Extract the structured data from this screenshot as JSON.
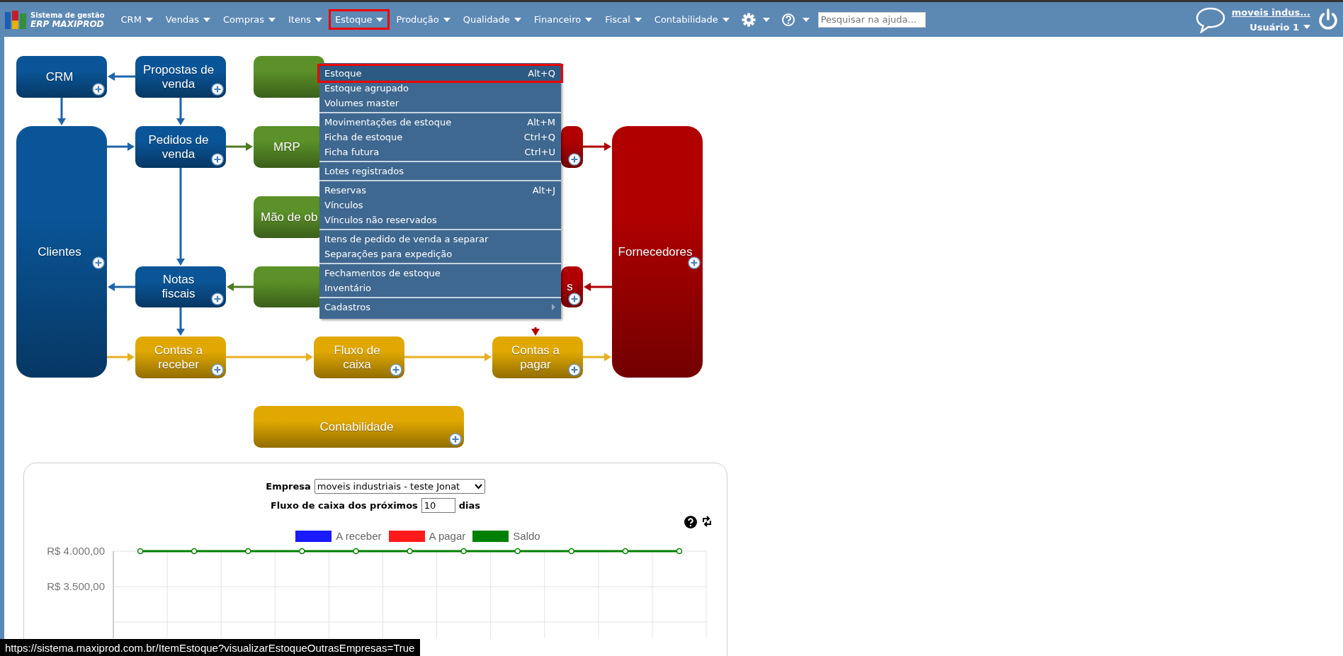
{
  "header": {
    "logo_line1": "Sistema de gestão",
    "logo_line2": "ERP MAXIPROD",
    "nav": [
      {
        "label": "CRM",
        "selected": false
      },
      {
        "label": "Vendas",
        "selected": false
      },
      {
        "label": "Compras",
        "selected": false
      },
      {
        "label": "Itens",
        "selected": false
      },
      {
        "label": "Estoque",
        "selected": true
      },
      {
        "label": "Produção",
        "selected": false
      },
      {
        "label": "Qualidade",
        "selected": false
      },
      {
        "label": "Financeiro",
        "selected": false
      },
      {
        "label": "Fiscal",
        "selected": false
      },
      {
        "label": "Contabilidade",
        "selected": false
      }
    ],
    "tool_menus": [
      {
        "kind": "settings"
      },
      {
        "kind": "help"
      }
    ],
    "search": {
      "placeholder": "Pesquisar na ajuda..."
    },
    "company_link": "moveis indus...",
    "user": "Usuário 1"
  },
  "menu": {
    "groups": [
      {
        "items": [
          {
            "kind": "item",
            "label": "Estoque",
            "shortcut": "Alt+Q",
            "selected": true
          },
          {
            "kind": "item",
            "label": "Estoque agrupado",
            "selected": false
          },
          {
            "kind": "item",
            "label": "Volumes master",
            "selected": false
          }
        ]
      },
      {
        "items": [
          {
            "kind": "item",
            "label": "Movimentações de estoque",
            "shortcut": "Alt+M",
            "selected": false
          },
          {
            "kind": "item",
            "label": "Ficha de estoque",
            "shortcut": "Ctrl+Q",
            "selected": false
          },
          {
            "kind": "item",
            "label": "Ficha futura",
            "shortcut": "Ctrl+U",
            "selected": false
          }
        ]
      },
      {
        "items": [
          {
            "kind": "item",
            "label": "Lotes registrados",
            "selected": false
          }
        ]
      },
      {
        "items": [
          {
            "kind": "item",
            "label": "Reservas",
            "shortcut": "Alt+J",
            "selected": false
          },
          {
            "kind": "item",
            "label": "Vínculos",
            "selected": false
          },
          {
            "kind": "item",
            "label": "Vínculos não reservados",
            "selected": false
          }
        ]
      },
      {
        "items": [
          {
            "kind": "item",
            "label": "Itens de pedido de venda a separar",
            "selected": false
          },
          {
            "kind": "item",
            "label": "Separações para expedição",
            "selected": false
          }
        ]
      },
      {
        "items": [
          {
            "kind": "item",
            "label": "Fechamentos de estoque",
            "selected": false
          },
          {
            "kind": "item",
            "label": "Inventário",
            "selected": false
          }
        ]
      },
      {
        "items": [
          {
            "kind": "submenu",
            "label": "Cadastros",
            "selected": false
          }
        ]
      }
    ]
  },
  "diagram": {
    "nodes": [
      {
        "label": "CRM",
        "color": "#0a5598",
        "add_button": true
      },
      {
        "label": "Propostas de\nvenda",
        "color": "#0a5598",
        "add_button": true
      },
      {
        "color": "#5b9128",
        "add_button": false
      },
      {
        "label": "Clientes",
        "color": "#0a5598",
        "add_button": true
      },
      {
        "label": "Pedidos de\nvenda",
        "color": "#0a5598",
        "add_button": true
      },
      {
        "label": "MRP",
        "color": "#5b9128",
        "add_button": false
      },
      {
        "label": "Mão de ob",
        "color": "#5b9128",
        "add_button": false
      },
      {
        "label": "Notas\nfiscais",
        "color": "#0a5598",
        "add_button": true
      },
      {
        "color": "#5b9128",
        "add_button": false
      },
      {
        "label": "Contas a\nreceber",
        "color": "#e0a800",
        "add_button": true
      },
      {
        "label": "Fluxo de\ncaixa",
        "color": "#e0a800",
        "add_button": true
      },
      {
        "label": "Contas a\npagar",
        "color": "#e0a800",
        "add_button": true
      },
      {
        "label": "Fornecedores",
        "color": "#b00000",
        "add_button": true
      },
      {
        "color": "#b00000",
        "add_button": true
      },
      {
        "label": "s",
        "color": "#b00000",
        "add_button": true
      },
      {
        "label": "Contabilidade",
        "color": "#e0a800",
        "add_button": true
      }
    ]
  },
  "cash_flow": {
    "company_label": "Empresa",
    "company_value": "moveis industriais - teste Jonat",
    "days_label": "Fluxo de caixa dos próximos",
    "days_value": "10",
    "days_unit": "dias",
    "chart": {
      "axis_labels": [
        "R$ 4.000,00",
        "R$ 3.500,00"
      ],
      "legend": [
        {
          "name": "A receber",
          "color": "#1a1aff"
        },
        {
          "name": "A pagar",
          "color": "#ff1a1a"
        },
        {
          "name": "Saldo",
          "color": "#008000"
        }
      ]
    }
  },
  "status_bar": "https://sistema.maxiprod.com.br/ItemEstoque?visualizarEstoqueOutrasEmpresas=True"
}
